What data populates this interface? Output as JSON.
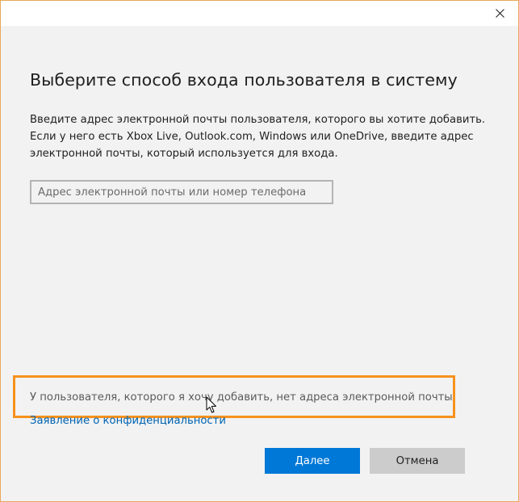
{
  "dialog": {
    "heading": "Выберите способ входа пользователя в систему",
    "description_lines": [
      "Введите адрес электронной почты пользователя, которого вы хотите добавить.",
      "Если у него есть Xbox Live, Outlook.com, Windows или OneDrive, введите адрес",
      "электронной почты, который используется для входа."
    ],
    "email_input": {
      "value": "",
      "placeholder": "Адрес электронной почты или номер телефона"
    },
    "no_email_link": "У пользователя, которого я хочу добавить, нет адреса электронной почты",
    "privacy_link": "Заявление о конфиденциальности",
    "next_button": "Далее",
    "cancel_button": "Отмена"
  },
  "icons": {
    "close": "close-icon",
    "cursor": "mouse-pointer-icon"
  },
  "colors": {
    "accent": "#0078d7",
    "link": "#0063b1",
    "highlight": "#f7911d",
    "dialog_background": "#f2f2f2",
    "window_border": "#e8a85a"
  }
}
